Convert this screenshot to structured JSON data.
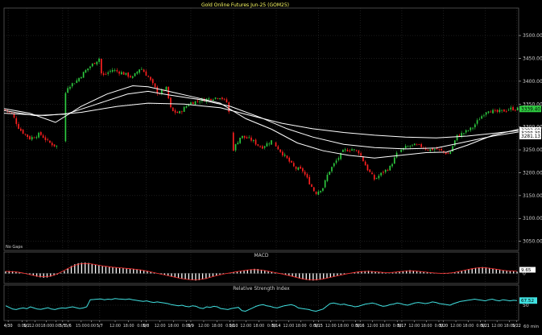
{
  "chart_data": {
    "type": "candlestick",
    "title": "Gold Online Futures Jun-25 (GOM25)",
    "annotation": "No Gaps",
    "colors": {
      "up": "#2ecc40",
      "down": "#ff2020",
      "ma": "#ffffff",
      "grid": "#3a3a3a",
      "axis": "#cfcfcf",
      "macd_hist": "#ffffff",
      "macd_signal": "#ff3030",
      "rsi": "#40e0e0",
      "title": "#ffff66"
    },
    "price_axis": {
      "ylim": [
        3030,
        3560
      ],
      "ticks": [
        "3500.00",
        "3450.00",
        "3400.00",
        "3350.00",
        "3300.00",
        "3250.00",
        "3200.00",
        "3150.00",
        "3100.00",
        "3050.00"
      ],
      "labels": [
        {
          "text": "3339.40",
          "value": 3339.4,
          "bg": "#2ecc40",
          "fg": "#000000"
        },
        {
          "text": "3292.69",
          "value": 3292.69,
          "bg": "#ffffff",
          "fg": "#000000"
        },
        {
          "text": "3288.38",
          "value": 3286.5,
          "bg": "#ffffff",
          "fg": "#000000"
        },
        {
          "text": "3281.13",
          "value": 3280.0,
          "bg": "#ffffff",
          "fg": "#000000"
        }
      ]
    },
    "x_axis": {
      "range": [
        0,
        100
      ],
      "ticks": [
        {
          "x": 0.8,
          "label": "4/30"
        },
        {
          "x": 3.5,
          "label": "0:00"
        },
        {
          "x": 4.4,
          "label": "5/2"
        },
        {
          "x": 6.0,
          "label": "12:00"
        },
        {
          "x": 8.2,
          "label": "18:00"
        },
        {
          "x": 10.1,
          "label": "0:00"
        },
        {
          "x": 11.4,
          "label": "5/5"
        },
        {
          "x": 12.5,
          "label": "5/6"
        },
        {
          "x": 15.0,
          "label": "15:00"
        },
        {
          "x": 17.0,
          "label": "0:00"
        },
        {
          "x": 18.6,
          "label": "5/7"
        },
        {
          "x": 21.6,
          "label": "12:00"
        },
        {
          "x": 24.2,
          "label": "18:00"
        },
        {
          "x": 26.7,
          "label": "0:00"
        },
        {
          "x": 27.6,
          "label": "5/8"
        },
        {
          "x": 30.3,
          "label": "12:00"
        },
        {
          "x": 32.9,
          "label": "18:00"
        },
        {
          "x": 35.4,
          "label": "0:00"
        },
        {
          "x": 36.3,
          "label": "5/9"
        },
        {
          "x": 38.8,
          "label": "12:00"
        },
        {
          "x": 41.4,
          "label": "18:00"
        },
        {
          "x": 43.9,
          "label": "0:00"
        },
        {
          "x": 44.6,
          "label": "5/10"
        },
        {
          "x": 47.0,
          "label": "12:00"
        },
        {
          "x": 49.5,
          "label": "18:00"
        },
        {
          "x": 52.0,
          "label": "0:00"
        },
        {
          "x": 52.9,
          "label": "5/14"
        },
        {
          "x": 55.3,
          "label": "12:00"
        },
        {
          "x": 57.7,
          "label": "18:00"
        },
        {
          "x": 60.2,
          "label": "0:00"
        },
        {
          "x": 61.1,
          "label": "5/15"
        },
        {
          "x": 63.5,
          "label": "12:00"
        },
        {
          "x": 65.9,
          "label": "18:00"
        },
        {
          "x": 68.3,
          "label": "0:00"
        },
        {
          "x": 69.2,
          "label": "5/16"
        },
        {
          "x": 71.6,
          "label": "12:00"
        },
        {
          "x": 74.0,
          "label": "18:00"
        },
        {
          "x": 76.4,
          "label": "0:00"
        },
        {
          "x": 77.3,
          "label": "5/17"
        },
        {
          "x": 79.7,
          "label": "12:00"
        },
        {
          "x": 82.1,
          "label": "18:00"
        },
        {
          "x": 84.5,
          "label": "0:00"
        },
        {
          "x": 85.4,
          "label": "5/20"
        },
        {
          "x": 87.8,
          "label": "12:00"
        },
        {
          "x": 90.2,
          "label": "18:00"
        },
        {
          "x": 92.6,
          "label": "0:00"
        },
        {
          "x": 93.5,
          "label": "5/21"
        },
        {
          "x": 95.8,
          "label": "12:00"
        },
        {
          "x": 98.2,
          "label": "18:00"
        },
        {
          "x": 99.6,
          "label": "5/22"
        }
      ],
      "interval_label": "60 min"
    },
    "price_path": [
      [
        0,
        3338
      ],
      [
        1.5,
        3330
      ],
      [
        3,
        3295
      ],
      [
        5,
        3275
      ],
      [
        7,
        3285
      ],
      [
        8.5,
        3268
      ],
      [
        10,
        3258
      ],
      [
        11.5,
        3262
      ],
      [
        12,
        3385
      ],
      [
        14,
        3400
      ],
      [
        16,
        3425
      ],
      [
        18.5,
        3450
      ],
      [
        19,
        3410
      ],
      [
        21,
        3425
      ],
      [
        23,
        3418
      ],
      [
        25,
        3408
      ],
      [
        26.5,
        3430
      ],
      [
        28,
        3410
      ],
      [
        30,
        3372
      ],
      [
        31.5,
        3385
      ],
      [
        32.5,
        3335
      ],
      [
        34,
        3330
      ],
      [
        36,
        3352
      ],
      [
        38,
        3358
      ],
      [
        40,
        3362
      ],
      [
        42,
        3366
      ],
      [
        43.5,
        3352
      ],
      [
        44.5,
        3250
      ],
      [
        46,
        3280
      ],
      [
        48,
        3272
      ],
      [
        50,
        3255
      ],
      [
        52,
        3270
      ],
      [
        53.5,
        3250
      ],
      [
        55,
        3230
      ],
      [
        56.5,
        3210
      ],
      [
        58,
        3205
      ],
      [
        59.5,
        3175
      ],
      [
        60.5,
        3155
      ],
      [
        62,
        3168
      ],
      [
        63,
        3200
      ],
      [
        64.5,
        3225
      ],
      [
        66,
        3248
      ],
      [
        67.5,
        3252
      ],
      [
        69,
        3245
      ],
      [
        70.5,
        3210
      ],
      [
        72,
        3185
      ],
      [
        73.5,
        3200
      ],
      [
        75,
        3212
      ],
      [
        76.5,
        3245
      ],
      [
        78,
        3255
      ],
      [
        79.5,
        3260
      ],
      [
        81,
        3258
      ],
      [
        82.5,
        3250
      ],
      [
        84,
        3252
      ],
      [
        85.5,
        3245
      ],
      [
        86.5,
        3240
      ],
      [
        88,
        3280
      ],
      [
        89.5,
        3288
      ],
      [
        91,
        3298
      ],
      [
        92.5,
        3320
      ],
      [
        94,
        3338
      ],
      [
        95.5,
        3332
      ],
      [
        97,
        3335
      ],
      [
        98.5,
        3340
      ],
      [
        100,
        3339
      ]
    ],
    "ma_series": [
      {
        "name": "ma1",
        "points": [
          [
            0,
            3340
          ],
          [
            5,
            3330
          ],
          [
            10,
            3310
          ],
          [
            15,
            3345
          ],
          [
            20,
            3372
          ],
          [
            25,
            3390
          ],
          [
            28,
            3388
          ],
          [
            32,
            3378
          ],
          [
            37,
            3365
          ],
          [
            42,
            3352
          ],
          [
            47,
            3318
          ],
          [
            52,
            3295
          ],
          [
            57,
            3265
          ],
          [
            62,
            3248
          ],
          [
            67,
            3238
          ],
          [
            72,
            3232
          ],
          [
            77,
            3238
          ],
          [
            82,
            3244
          ],
          [
            86,
            3245
          ],
          [
            90,
            3260
          ],
          [
            95,
            3282
          ],
          [
            100,
            3295
          ]
        ]
      },
      {
        "name": "ma2",
        "points": [
          [
            0,
            3336
          ],
          [
            6,
            3325
          ],
          [
            12,
            3328
          ],
          [
            18,
            3350
          ],
          [
            24,
            3372
          ],
          [
            28,
            3378
          ],
          [
            32,
            3370
          ],
          [
            38,
            3360
          ],
          [
            44,
            3345
          ],
          [
            50,
            3320
          ],
          [
            55,
            3296
          ],
          [
            60,
            3278
          ],
          [
            66,
            3262
          ],
          [
            72,
            3255
          ],
          [
            78,
            3252
          ],
          [
            84,
            3254
          ],
          [
            90,
            3268
          ],
          [
            95,
            3280
          ],
          [
            100,
            3289
          ]
        ]
      },
      {
        "name": "ma3",
        "points": [
          [
            0,
            3330
          ],
          [
            8,
            3325
          ],
          [
            15,
            3332
          ],
          [
            22,
            3345
          ],
          [
            28,
            3352
          ],
          [
            35,
            3350
          ],
          [
            42,
            3342
          ],
          [
            48,
            3325
          ],
          [
            54,
            3308
          ],
          [
            60,
            3296
          ],
          [
            66,
            3288
          ],
          [
            72,
            3282
          ],
          [
            78,
            3278
          ],
          [
            84,
            3276
          ],
          [
            90,
            3280
          ],
          [
            95,
            3286
          ],
          [
            100,
            3292
          ]
        ]
      }
    ],
    "macd": {
      "title": "MACD",
      "ylim": [
        -1,
        1
      ],
      "label": {
        "text": "9.65",
        "bg": "#ffffff",
        "fg": "#000000"
      },
      "ticks": [
        "0"
      ],
      "histogram": [
        0.18,
        0.22,
        0.2,
        0.16,
        0.1,
        0.05,
        0.02,
        -0.08,
        -0.2,
        -0.3,
        -0.36,
        -0.4,
        -0.38,
        -0.3,
        -0.2,
        -0.1,
        0.05,
        0.22,
        0.46,
        0.68,
        0.84,
        0.94,
        0.98,
        1.0,
        0.96,
        0.88,
        0.8,
        0.74,
        0.66,
        0.62,
        0.6,
        0.58,
        0.55,
        0.5,
        0.48,
        0.46,
        0.44,
        0.42,
        0.38,
        0.34,
        0.3,
        0.22,
        0.14,
        0.06,
        0.0,
        -0.08,
        -0.14,
        -0.2,
        -0.28,
        -0.36,
        -0.44,
        -0.5,
        -0.54,
        -0.58,
        -0.62,
        -0.66,
        -0.62,
        -0.56,
        -0.5,
        -0.4,
        -0.28,
        -0.18,
        -0.1,
        -0.04,
        0.0,
        0.04,
        0.1,
        0.16,
        0.22,
        0.28,
        0.32,
        0.38,
        0.42,
        0.4,
        0.34,
        0.28,
        0.2,
        0.12,
        0.06,
        0.02,
        -0.04,
        -0.1,
        -0.18,
        -0.26,
        -0.36,
        -0.46,
        -0.54,
        -0.6,
        -0.64,
        -0.66,
        -0.64,
        -0.58,
        -0.5,
        -0.44,
        -0.38,
        -0.3,
        -0.22,
        -0.14,
        -0.08,
        -0.02,
        0.04,
        0.1,
        0.16,
        0.2,
        0.22,
        0.24,
        0.2,
        0.16,
        0.12,
        0.08,
        0.04,
        0.02,
        0.06,
        0.1,
        0.16,
        0.22,
        0.26,
        0.3,
        0.26,
        0.22,
        0.18,
        0.14,
        0.1,
        0.06,
        0.04,
        0.02,
        -0.02,
        -0.04,
        -0.02,
        0.02,
        0.08,
        0.14,
        0.22,
        0.3,
        0.38,
        0.46,
        0.52,
        0.56,
        0.58,
        0.56,
        0.5,
        0.44,
        0.38,
        0.32,
        0.28,
        0.24,
        0.2,
        0.18,
        0.16
      ]
    },
    "rsi": {
      "title": "Relative Strength Index",
      "ylim": [
        0,
        100
      ],
      "ticks": [
        "50"
      ],
      "label": {
        "text": "67.52",
        "bg": "#40e0e0",
        "fg": "#000000"
      },
      "values": [
        48,
        42,
        36,
        34,
        38,
        40,
        37,
        44,
        40,
        36,
        35,
        38,
        41,
        36,
        34,
        38,
        40,
        39,
        42,
        44,
        41,
        38,
        40,
        44,
        70,
        71,
        72,
        73,
        70,
        72,
        71,
        74,
        73,
        72,
        71,
        73,
        70,
        68,
        66,
        64,
        66,
        62,
        60,
        62,
        60,
        58,
        56,
        52,
        50,
        48,
        50,
        46,
        44,
        48,
        46,
        40,
        38,
        44,
        42,
        46,
        44,
        38,
        36,
        34,
        38,
        40,
        42,
        30,
        28,
        34,
        40,
        46,
        50,
        52,
        48,
        46,
        42,
        40,
        44,
        48,
        50,
        52,
        48,
        40,
        38,
        36,
        34,
        30,
        28,
        32,
        36,
        46,
        56,
        58,
        55,
        52,
        54,
        50,
        48,
        44,
        46,
        50,
        54,
        56,
        58,
        55,
        50,
        46,
        48,
        52,
        54,
        58,
        56,
        52,
        50,
        54,
        58,
        60,
        58,
        56,
        58,
        62,
        60,
        56,
        54,
        52,
        50,
        56,
        60,
        64,
        66,
        68,
        70,
        72,
        70,
        68,
        66,
        70,
        72,
        68,
        66,
        70,
        68,
        66,
        68,
        67
      ]
    }
  }
}
